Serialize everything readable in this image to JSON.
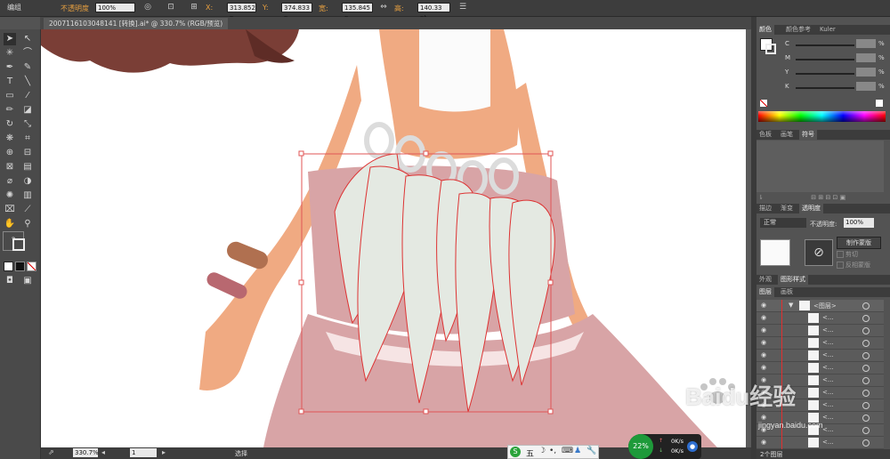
{
  "menu": {
    "label": "编组"
  },
  "toolbar": {
    "opacity_label": "不透明度",
    "opacity_value": "100%",
    "x_label": "X:",
    "x_value": "313.852 p",
    "y_label": "Y:",
    "y_value": "374.833 p",
    "w_label": "宽:",
    "w_value": "135.845 p",
    "h_label": "高:",
    "h_value": "140.33 pt"
  },
  "document": {
    "tab_title": "2007116103048141 [转换].ai* @ 330.7% (RGB/预览)"
  },
  "status": {
    "zoom": "330.7%",
    "page": "1",
    "tool": "选择"
  },
  "panels": {
    "color_tabs": [
      "颜色",
      "颜色参考",
      "Kuler"
    ],
    "cmyk": [
      "C",
      "M",
      "Y",
      "K"
    ],
    "pct": "%",
    "swatch_tabs": [
      "色板",
      "画笔",
      "符号"
    ],
    "stroke_tabs": [
      "描边",
      "渐变",
      "透明度"
    ],
    "blend_mode": "正常",
    "opacity_label": "不透明度:",
    "opacity_value": "100%",
    "make_mask": "制作蒙版",
    "clip": "剪切",
    "invert_mask": "反相蒙版",
    "appearance_tabs": [
      "外观",
      "图形样式"
    ],
    "layer_tabs": [
      "图层",
      "画板"
    ],
    "layer_group": "<图层>",
    "layer_items": [
      "<...",
      "<...",
      "<...",
      "<...",
      "<...",
      "<...",
      "<...",
      "<...",
      "<...",
      "<...",
      "<...",
      "<..."
    ],
    "layer_count": "2个图层"
  },
  "ime": {
    "label": "五"
  },
  "netspeed": {
    "percent": "22%",
    "up": "0K/s",
    "down": "0K/s"
  },
  "watermark": {
    "brand": "Baidu经验",
    "url": "jingyan.baidu.com"
  }
}
